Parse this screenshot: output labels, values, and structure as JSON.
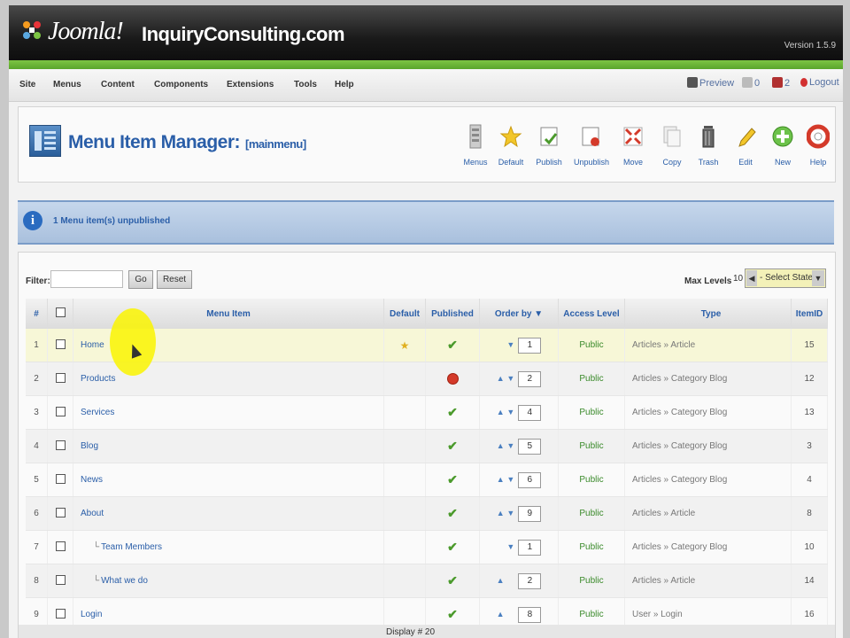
{
  "header": {
    "logo_text": "Joomla!",
    "site_name": "InquiryConsulting.com",
    "version": "Version 1.5.9"
  },
  "menubar": {
    "items": [
      "Site",
      "Menus",
      "Content",
      "Components",
      "Extensions",
      "Tools",
      "Help"
    ],
    "preview": "Preview",
    "messages_count": "0",
    "users_count": "2",
    "logout": "Logout"
  },
  "toolbar": {
    "title": "Menu Item Manager:",
    "subtitle": "[mainmenu]",
    "buttons": [
      "Menus",
      "Default",
      "Publish",
      "Unpublish",
      "Move",
      "Copy",
      "Trash",
      "Edit",
      "New",
      "Help"
    ]
  },
  "message": {
    "text": "1 Menu item(s) unpublished"
  },
  "filter": {
    "label": "Filter:",
    "value": "",
    "go_label": "Go",
    "reset_label": "Reset",
    "max_levels_label": "Max Levels",
    "max_levels_value": "10",
    "state_value": "- Select State -"
  },
  "table": {
    "headers": {
      "num": "#",
      "name": "Menu Item",
      "default": "Default",
      "published": "Published",
      "order": "Order by",
      "access": "Access Level",
      "type": "Type",
      "itemid": "ItemID"
    },
    "rows": [
      {
        "num": "1",
        "name": "Home",
        "default": true,
        "published": true,
        "up": false,
        "down": true,
        "order": "1",
        "access": "Public",
        "type": "Articles » Article",
        "id": "15",
        "child": false
      },
      {
        "num": "2",
        "name": "Products",
        "default": false,
        "published": false,
        "up": true,
        "down": true,
        "order": "2",
        "access": "Public",
        "type": "Articles » Category Blog",
        "id": "12",
        "child": false
      },
      {
        "num": "3",
        "name": "Services",
        "default": false,
        "published": true,
        "up": true,
        "down": true,
        "order": "4",
        "access": "Public",
        "type": "Articles » Category Blog",
        "id": "13",
        "child": false
      },
      {
        "num": "4",
        "name": "Blog",
        "default": false,
        "published": true,
        "up": true,
        "down": true,
        "order": "5",
        "access": "Public",
        "type": "Articles » Category Blog",
        "id": "3",
        "child": false
      },
      {
        "num": "5",
        "name": "News",
        "default": false,
        "published": true,
        "up": true,
        "down": true,
        "order": "6",
        "access": "Public",
        "type": "Articles » Category Blog",
        "id": "4",
        "child": false
      },
      {
        "num": "6",
        "name": "About",
        "default": false,
        "published": true,
        "up": true,
        "down": true,
        "order": "9",
        "access": "Public",
        "type": "Articles » Article",
        "id": "8",
        "child": false
      },
      {
        "num": "7",
        "name": "Team Members",
        "default": false,
        "published": true,
        "up": false,
        "down": true,
        "order": "1",
        "access": "Public",
        "type": "Articles » Category Blog",
        "id": "10",
        "child": true
      },
      {
        "num": "8",
        "name": "What we do",
        "default": false,
        "published": true,
        "up": true,
        "down": false,
        "order": "2",
        "access": "Public",
        "type": "Articles » Article",
        "id": "14",
        "child": true
      },
      {
        "num": "9",
        "name": "Login",
        "default": false,
        "published": true,
        "up": true,
        "down": false,
        "order": "8",
        "access": "Public",
        "type": "User » Login",
        "id": "16",
        "child": false
      }
    ]
  },
  "footer": {
    "text": "Display # 20"
  },
  "colors": {
    "accent": "#2a5ea8",
    "header_green": "#6bb536",
    "public_green": "#3a8a2a"
  }
}
